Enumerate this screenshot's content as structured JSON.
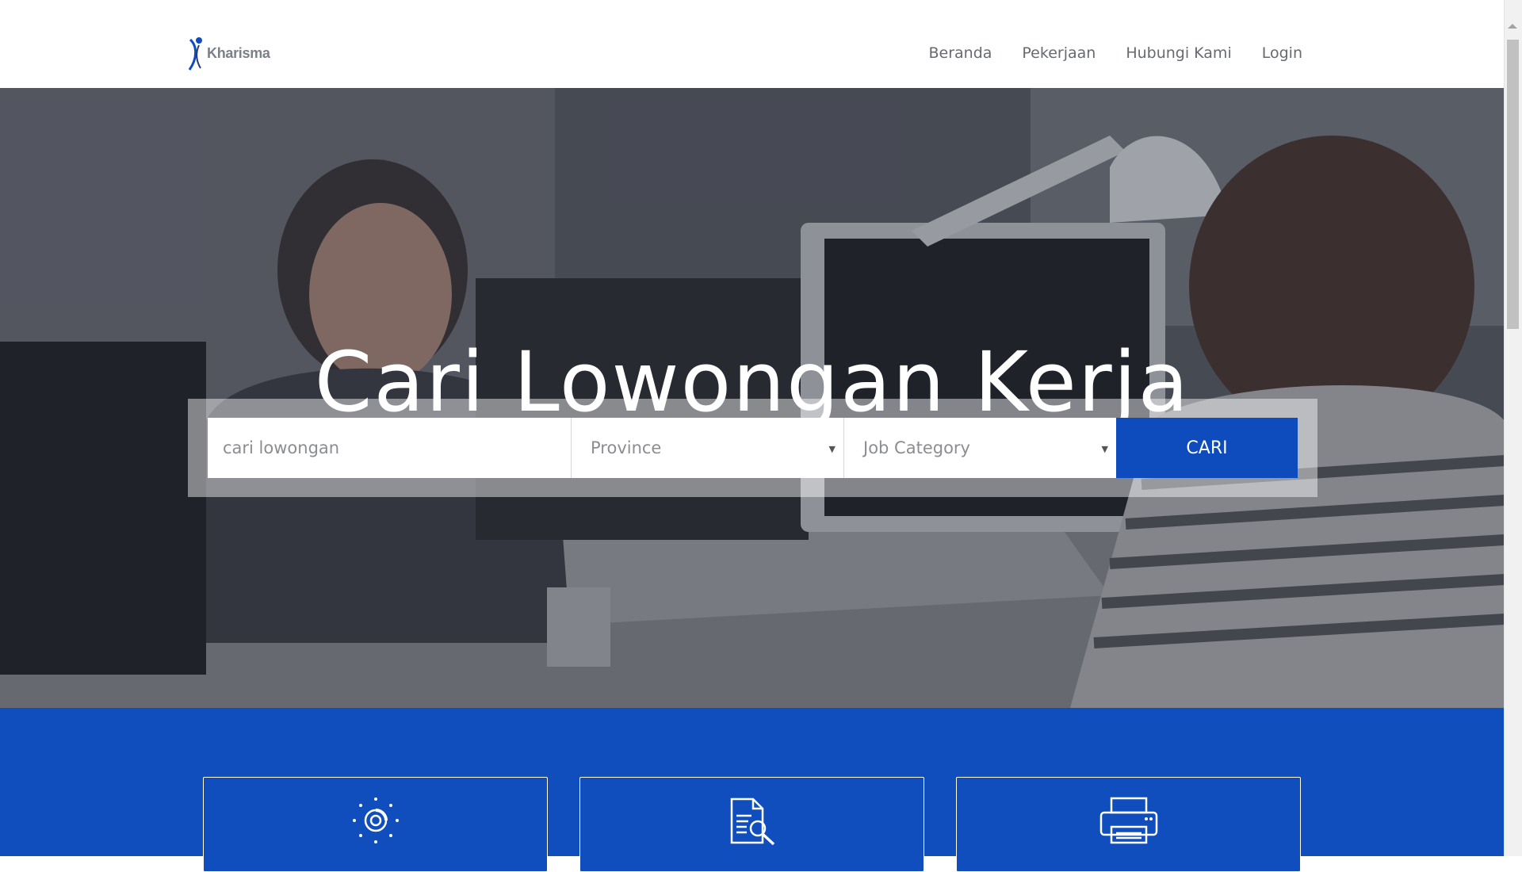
{
  "brand": {
    "name": "Kharisma"
  },
  "nav": {
    "items": [
      "Beranda",
      "Pekerjaan",
      "Hubungi Kami",
      "Login"
    ]
  },
  "hero": {
    "title": "Cari Lowongan Kerja",
    "search": {
      "placeholder": "cari lowongan",
      "province": "Province",
      "category": "Job Category",
      "button": "CARI"
    }
  },
  "features": {
    "icons": [
      "target-icon",
      "document-search-icon",
      "printer-icon"
    ]
  },
  "colors": {
    "primary": "#0e4bbd",
    "features_bg": "#0f4ebc",
    "nav_text": "#666a70"
  }
}
